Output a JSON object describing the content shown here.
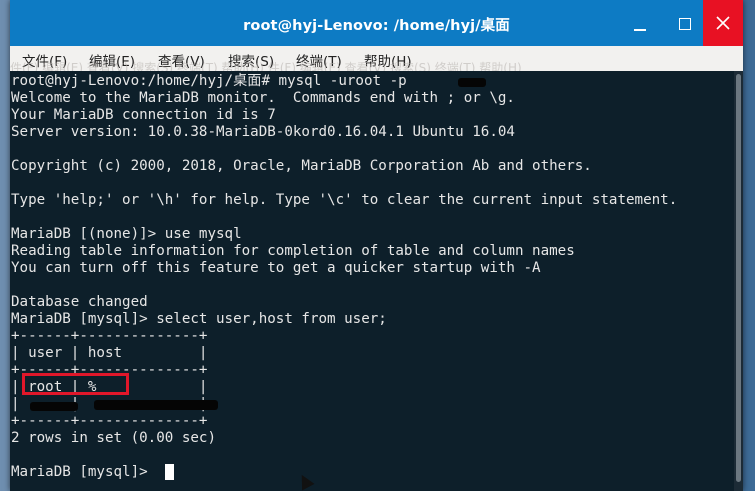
{
  "window": {
    "title": "root@hyj-Lenovo: /home/hyj/桌面",
    "controls": {
      "minimize": "minimize",
      "maximize": "maximize",
      "close": "close"
    }
  },
  "menu": {
    "items": [
      "文件(F)",
      "编辑(E)",
      "查看(V)",
      "搜索(S)",
      "终端(T)",
      "帮助(H)"
    ]
  },
  "background_text": "件(F)  编辑(E)  查看(V)  搜索(S)  终端(T)  帮助(H)          件(F) 编辑(E) 查看(V) 搜索(S) 终端(T) 帮助(H)",
  "terminal": {
    "lines": [
      "root@hyj-Lenovo:/home/hyj/桌面# mysql -uroot -p",
      "Welcome to the MariaDB monitor.  Commands end with ; or \\g.",
      "Your MariaDB connection id is 7",
      "Server version: 10.0.38-MariaDB-0kord0.16.04.1 Ubuntu 16.04",
      "",
      "Copyright (c) 2000, 2018, Oracle, MariaDB Corporation Ab and others.",
      "",
      "Type 'help;' or '\\h' for help. Type '\\c' to clear the current input statement.",
      "",
      "MariaDB [(none)]> use mysql",
      "Reading table information for completion of table and column names",
      "You can turn off this feature to get a quicker startup with -A",
      "",
      "Database changed",
      "MariaDB [mysql]> select user,host from user;",
      "+------+--------------+",
      "| user | host         |",
      "+------+--------------+",
      "| root | %            |",
      "|      |              |",
      "+------+--------------+",
      "2 rows in set (0.00 sec)",
      "",
      "MariaDB [mysql]> "
    ]
  }
}
